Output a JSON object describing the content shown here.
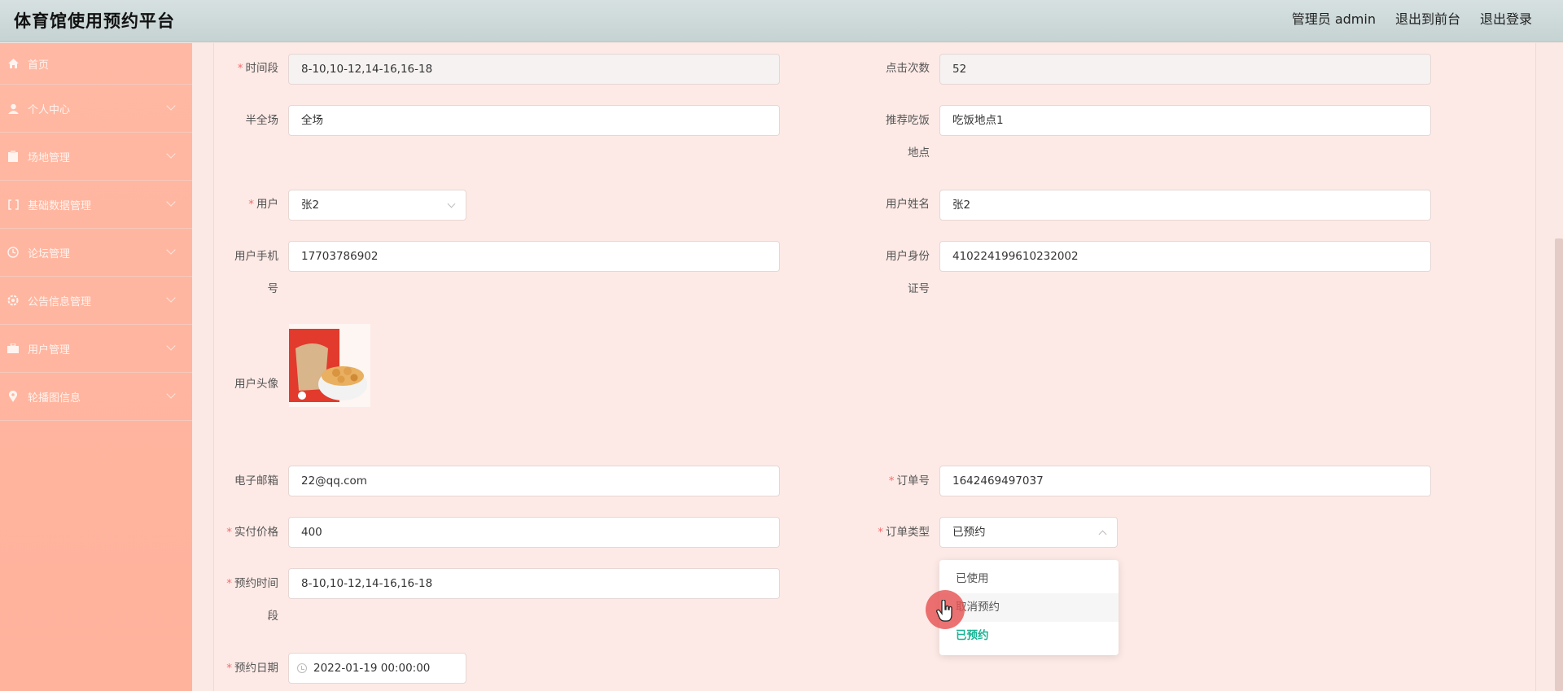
{
  "header": {
    "title": "体育馆使用预约平台",
    "admin": "管理员 admin",
    "to_front": "退出到前台",
    "logout": "退出登录"
  },
  "sidebar": {
    "items": [
      {
        "label": "首页",
        "icon": "home-icon"
      },
      {
        "label": "个人中心",
        "icon": "user-icon"
      },
      {
        "label": "场地管理",
        "icon": "clipboard-icon"
      },
      {
        "label": "基础数据管理",
        "icon": "bracket-icon"
      },
      {
        "label": "论坛管理",
        "icon": "clock-icon"
      },
      {
        "label": "公告信息管理",
        "icon": "settings-icon"
      },
      {
        "label": "用户管理",
        "icon": "briefcase-icon"
      },
      {
        "label": "轮播图信息",
        "icon": "map-pin-icon"
      }
    ]
  },
  "form": {
    "time_slot": {
      "label": "时间段",
      "value": "8-10,10-12,14-16,16-18"
    },
    "click_count": {
      "label": "点击次数",
      "value": "52"
    },
    "court_type": {
      "label": "半全场",
      "value": "全场"
    },
    "restaurant": {
      "label_line1": "推荐吃饭",
      "label_line2": "地点",
      "value": "吃饭地点1"
    },
    "user": {
      "label": "用户",
      "value": "张2"
    },
    "user_name": {
      "label": "用户姓名",
      "value": "张2"
    },
    "phone": {
      "label_line1": "用户手机",
      "label_line2": "号",
      "value": "17703786902"
    },
    "id_card": {
      "label_line1": "用户身份",
      "label_line2": "证号",
      "value": "410224199610232002"
    },
    "avatar": {
      "label": "用户头像"
    },
    "email": {
      "label": "电子邮箱",
      "value": "22@qq.com"
    },
    "order_no": {
      "label": "订单号",
      "value": "1642469497037"
    },
    "price": {
      "label": "实付价格",
      "value": "400"
    },
    "order_type": {
      "label": "订单类型",
      "value": "已预约"
    },
    "reserve_slot": {
      "label_line1": "预约时间",
      "label_line2": "段",
      "value": "8-10,10-12,14-16,16-18"
    },
    "reserve_date": {
      "label": "预约日期",
      "value": "2022-01-19 00:00:00"
    }
  },
  "dropdown": {
    "options": [
      "已使用",
      "取消预约",
      "已预约"
    ],
    "selected": "已预约"
  },
  "colors": {
    "sidebar": "#ffb4a0",
    "accent": "#1ab394",
    "required": "#f56c6c"
  }
}
